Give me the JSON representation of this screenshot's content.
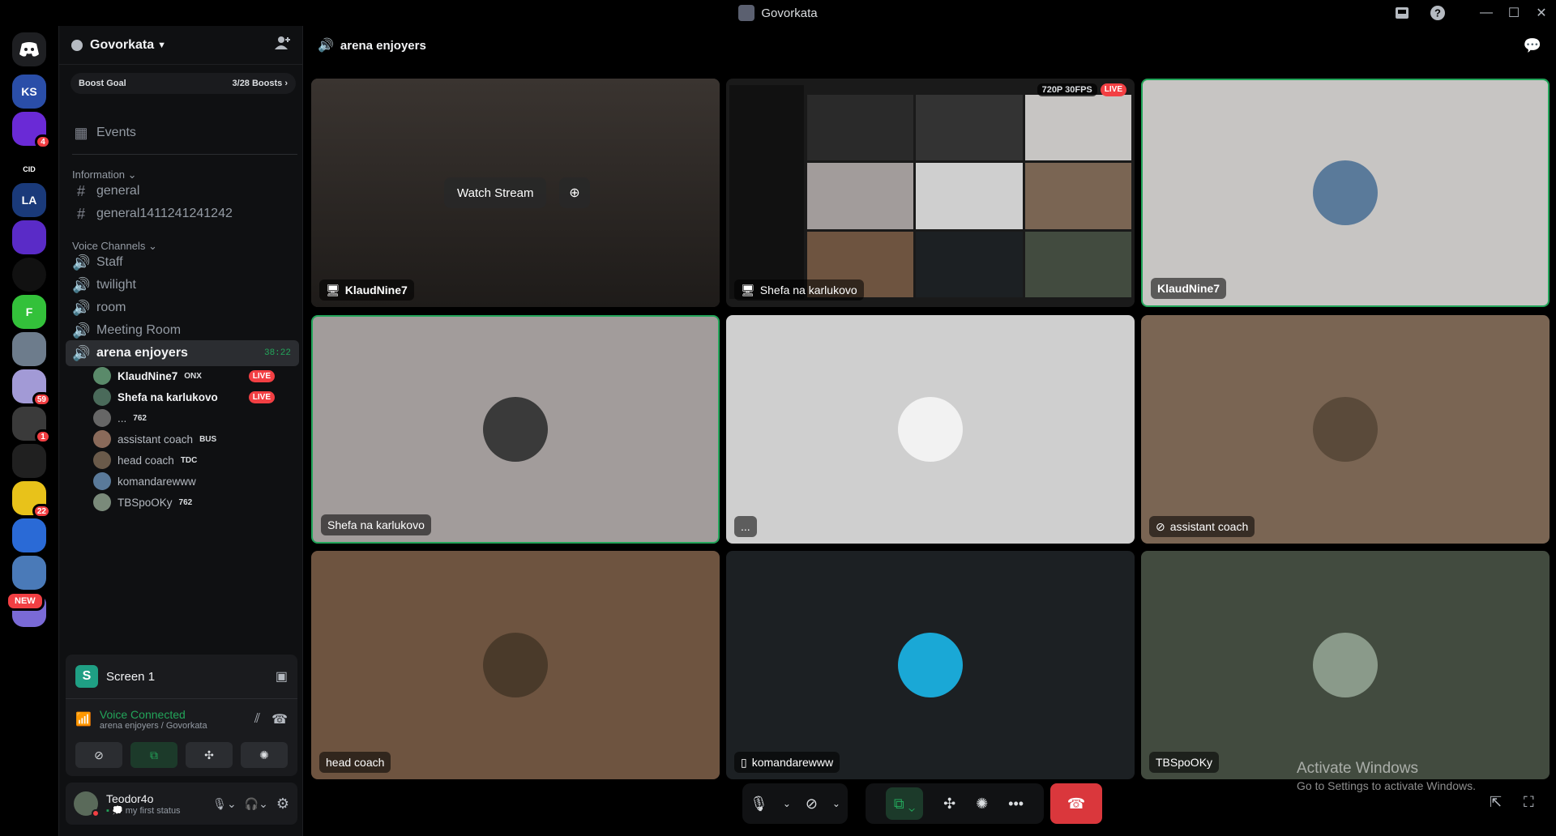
{
  "window": {
    "title": "Govorkata",
    "icon": "app-icon"
  },
  "servers": [
    {
      "label": "KS",
      "color": "#2a4ea8"
    },
    {
      "label": "",
      "color": "#6a2ad6",
      "badge": "4"
    },
    {
      "label": "CID",
      "color": "#000000"
    },
    {
      "label": "LA",
      "color": "#1a3a7a"
    },
    {
      "label": "",
      "color": "#5a2bc7"
    },
    {
      "label": "",
      "color": "#111111"
    },
    {
      "label": "F",
      "color": "#33c13a"
    },
    {
      "label": "",
      "color": "#6d7c8c"
    },
    {
      "label": "",
      "color": "#a29ad6",
      "badge": "59"
    },
    {
      "label": "",
      "color": "#3a3a3a",
      "badge": "1"
    },
    {
      "label": "",
      "color": "#202020"
    },
    {
      "label": "",
      "color": "#e8c21a",
      "badge": "22"
    },
    {
      "label": "",
      "color": "#2a6ad6"
    },
    {
      "label": "",
      "color": "#4a7ab8"
    },
    {
      "label": "",
      "color": "#7a6ad6",
      "new": "NEW"
    }
  ],
  "guild": {
    "name": "Govorkata"
  },
  "boost": {
    "label": "Boost Goal",
    "progress": "3/28 Boosts"
  },
  "events_label": "Events",
  "text_category": "Information",
  "text_channels": [
    "general",
    "general1411241241242"
  ],
  "voice_category": "Voice Channels",
  "voice_channels": [
    "Staff",
    "twilight",
    "room",
    "Meeting Room"
  ],
  "active_channel": {
    "name": "arena enjoyers",
    "timer": "38:22"
  },
  "voice_users": [
    {
      "name": "KlaudNine7",
      "tag": "ONX",
      "live": "LIVE",
      "color": "#5a8a6a"
    },
    {
      "name": "Shefa na karlukovo",
      "tag": "",
      "live": "LIVE",
      "color": "#4a6a5a"
    },
    {
      "name": "...",
      "tag": "762",
      "live": "",
      "color": "#666666"
    },
    {
      "name": "assistant coach",
      "tag": "BUS",
      "live": "",
      "color": "#8a6a5a"
    },
    {
      "name": "head coach",
      "tag": "TDC",
      "live": "",
      "color": "#6a5a4a"
    },
    {
      "name": "komandarewww",
      "tag": "",
      "live": "",
      "color": "#5a7a9a"
    },
    {
      "name": "TBSpoOKy",
      "tag": "762",
      "live": "",
      "color": "#7a8a7a"
    }
  ],
  "screen_share": {
    "title": "Screen 1"
  },
  "voice_status": {
    "title": "Voice Connected",
    "subtitle": "arena enjoyers / Govorkata"
  },
  "user": {
    "name": "Teodor4o",
    "status": "my first status"
  },
  "main_header": {
    "channel": "arena enjoyers"
  },
  "tiles": [
    {
      "name": "KlaudNine7",
      "bg": "#2a2624",
      "watch": "Watch Stream"
    },
    {
      "name": "Shefa na karlukovo",
      "bg": "#1a1a1a",
      "quality": "720P 30FPS",
      "live": "LIVE"
    },
    {
      "name": "KlaudNine7",
      "bg": "#c7c5c3"
    },
    {
      "name": "Shefa na karlukovo",
      "bg": "#a29c9b"
    },
    {
      "name": "...",
      "bg": "#cfcfcf"
    },
    {
      "name": "assistant coach",
      "bg": "#7a6553"
    },
    {
      "name": "head coach",
      "bg": "#6e5440"
    },
    {
      "name": "komandarewww",
      "bg": "#1c2023"
    },
    {
      "name": "TBSpoOKy",
      "bg": "#424b3f"
    }
  ],
  "activate_windows": {
    "title": "Activate Windows",
    "subtitle": "Go to Settings to activate Windows."
  }
}
